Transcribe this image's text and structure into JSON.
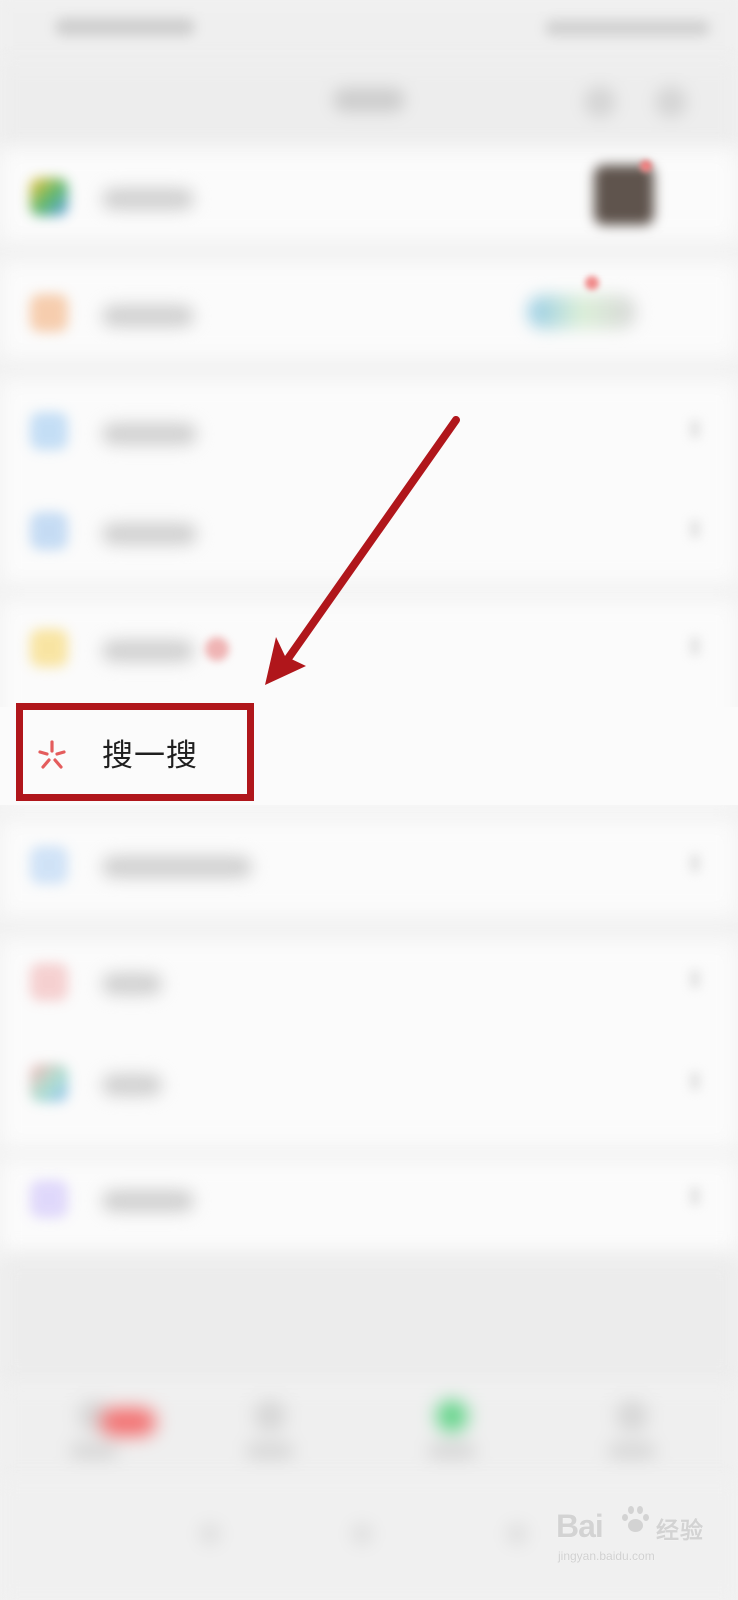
{
  "focused_item": {
    "label": "搜一搜",
    "icon": "search-spark-icon",
    "accent_color": "#e45c5c"
  },
  "annotation": {
    "box_color": "#b0161b",
    "arrow_color": "#b0161b"
  },
  "watermark": {
    "main": "Bai",
    "sub": "经验",
    "url": "jingyan.baidu.com"
  }
}
